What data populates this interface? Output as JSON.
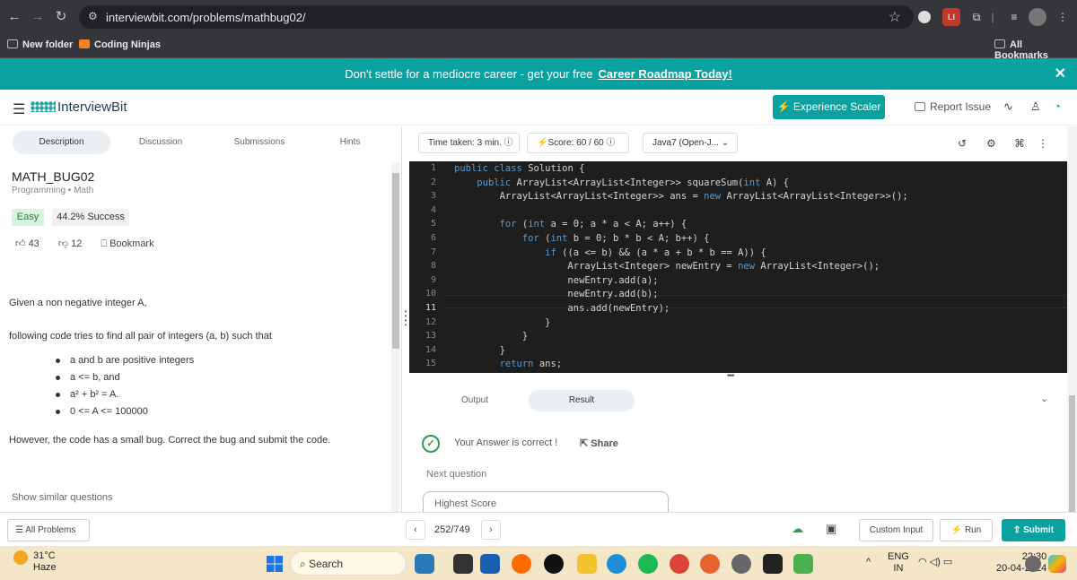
{
  "browser": {
    "url": "interviewbit.com/problems/mathbug02/",
    "bookmarks": [
      "New folder",
      "Coding Ninjas"
    ],
    "all_bookmarks": "All Bookmarks"
  },
  "banner": {
    "text": "Don't settle for a mediocre career - get your free",
    "link": "Career Roadmap Today!",
    "close": "✕"
  },
  "header": {
    "logo": "InterviewBit",
    "scaler_button": "⚡ Experience Scaler",
    "report_issue": "Report Issue"
  },
  "left_tabs": [
    "Description",
    "Discussion",
    "Submissions",
    "Hints"
  ],
  "problem": {
    "title": "MATH_BUG02",
    "category": "Programming • Math",
    "difficulty": "Easy",
    "success": "44.2% Success",
    "likes": "43",
    "dislikes": "12",
    "bookmark": "Bookmark",
    "intro": "Given a non negative integer A,",
    "task": "following code tries to find all pair of integers (a, b) such that",
    "conditions": [
      "a and b are positive integers",
      "a  <=  b, and",
      "a² + b² = A.",
      "0 <= A <= 100000"
    ],
    "note": "However, the code has a small bug. Correct the bug and submit the code.",
    "similar": "Show similar questions"
  },
  "toolbar": {
    "time_taken": "Time taken: 3 min.",
    "score": "Score: 60 / 60",
    "language": "Java7 (Open-J..."
  },
  "editor": {
    "current_line": 11,
    "lines": [
      "public class Solution {",
      "    public ArrayList<ArrayList<Integer>> squareSum(int A) {",
      "        ArrayList<ArrayList<Integer>> ans = new ArrayList<ArrayList<Integer>>();",
      "",
      "        for (int a = 0; a * a < A; a++) {",
      "            for (int b = 0; b * b < A; b++) {",
      "                if ((a <= b) && (a * a + b * b == A)) {",
      "                    ArrayList<Integer> newEntry = new ArrayList<Integer>();",
      "                    newEntry.add(a);",
      "                    newEntry.add(b);",
      "                    ans.add(newEntry);",
      "                }",
      "            }",
      "        }",
      "        return ans;",
      "    }"
    ]
  },
  "output": {
    "tabs": [
      "Output",
      "Result"
    ],
    "answer": "Your Answer is correct !",
    "share": "Share",
    "next_question": "Next question",
    "highest_score": "Highest Score"
  },
  "footer": {
    "all_problems": "All Problems",
    "page": "252/749",
    "custom_input": "Custom Input",
    "run": "Run",
    "submit": "Submit"
  },
  "taskbar": {
    "temperature": "31°C",
    "weather": "Haze",
    "search": "Search",
    "lang_top": "ENG",
    "lang_bottom": "IN",
    "time": "22:30",
    "date": "20-04-2024"
  }
}
